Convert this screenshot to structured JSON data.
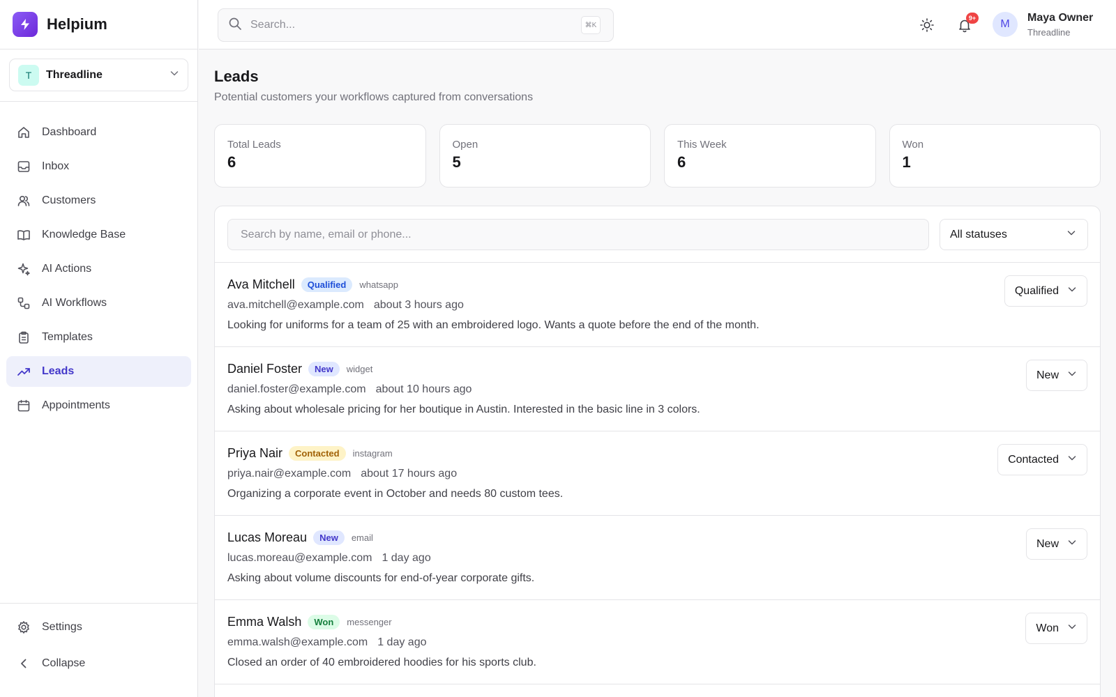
{
  "app": {
    "name": "Helpium"
  },
  "workspace": {
    "initial": "T",
    "name": "Threadline"
  },
  "nav": {
    "items": [
      {
        "label": "Dashboard",
        "icon": "home-icon"
      },
      {
        "label": "Inbox",
        "icon": "inbox-icon"
      },
      {
        "label": "Customers",
        "icon": "users-icon"
      },
      {
        "label": "Knowledge Base",
        "icon": "book-icon"
      },
      {
        "label": "AI Actions",
        "icon": "sparkles-icon"
      },
      {
        "label": "AI Workflows",
        "icon": "workflow-icon"
      },
      {
        "label": "Templates",
        "icon": "clipboard-icon"
      },
      {
        "label": "Leads",
        "icon": "trending-up-icon",
        "active": true
      },
      {
        "label": "Appointments",
        "icon": "calendar-icon"
      }
    ],
    "settings": "Settings",
    "collapse": "Collapse"
  },
  "header": {
    "search_placeholder": "Search...",
    "shortcut": "⌘K",
    "notifications_badge": "9+",
    "user": {
      "initial": "M",
      "name": "Maya Owner",
      "org": "Threadline"
    }
  },
  "page": {
    "title": "Leads",
    "subtitle": "Potential customers your workflows captured from conversations"
  },
  "stats": [
    {
      "label": "Total Leads",
      "value": "6"
    },
    {
      "label": "Open",
      "value": "5"
    },
    {
      "label": "This Week",
      "value": "6"
    },
    {
      "label": "Won",
      "value": "1"
    }
  ],
  "filters": {
    "search_placeholder": "Search by name, email or phone...",
    "status_selected": "All statuses"
  },
  "leads": [
    {
      "name": "Ava Mitchell",
      "status": "Qualified",
      "channel": "whatsapp",
      "email": "ava.mitchell@example.com",
      "ago": "about 3 hours ago",
      "note": "Looking for uniforms for a team of 25 with an embroidered logo. Wants a quote before the end of the month."
    },
    {
      "name": "Daniel Foster",
      "status": "New",
      "channel": "widget",
      "email": "daniel.foster@example.com",
      "ago": "about 10 hours ago",
      "note": "Asking about wholesale pricing for her boutique in Austin. Interested in the basic line in 3 colors."
    },
    {
      "name": "Priya Nair",
      "status": "Contacted",
      "channel": "instagram",
      "email": "priya.nair@example.com",
      "ago": "about 17 hours ago",
      "note": "Organizing a corporate event in October and needs 80 custom tees."
    },
    {
      "name": "Lucas Moreau",
      "status": "New",
      "channel": "email",
      "email": "lucas.moreau@example.com",
      "ago": "1 day ago",
      "note": "Asking about volume discounts for end-of-year corporate gifts."
    },
    {
      "name": "Emma Walsh",
      "status": "Won",
      "channel": "messenger",
      "email": "emma.walsh@example.com",
      "ago": "1 day ago",
      "note": "Closed an order of 40 embroidered hoodies for his sports club."
    }
  ]
}
